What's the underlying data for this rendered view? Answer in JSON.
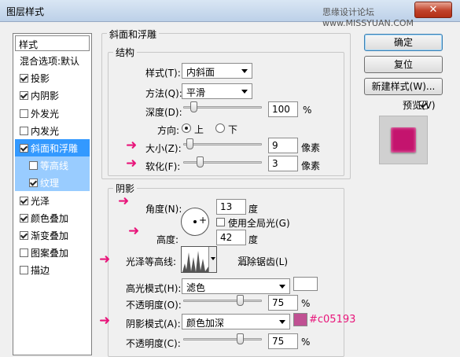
{
  "window": {
    "title": "图层样式",
    "watermark": "思缘设计论坛 www.MISSYUAN.COM",
    "close_icon": "✕"
  },
  "style_list": {
    "header": "样式",
    "items": [
      {
        "label": "混合选项:默认",
        "checkbox": false,
        "checked": false
      },
      {
        "label": "投影",
        "checkbox": true,
        "checked": true
      },
      {
        "label": "内阴影",
        "checkbox": true,
        "checked": true
      },
      {
        "label": "外发光",
        "checkbox": true,
        "checked": false
      },
      {
        "label": "内发光",
        "checkbox": true,
        "checked": false
      },
      {
        "label": "斜面和浮雕",
        "checkbox": true,
        "checked": true,
        "selected": true
      },
      {
        "label": "等高线",
        "checkbox": true,
        "checked": false,
        "sub": true
      },
      {
        "label": "纹理",
        "checkbox": true,
        "checked": true,
        "sub": true
      },
      {
        "label": "光泽",
        "checkbox": true,
        "checked": true
      },
      {
        "label": "颜色叠加",
        "checkbox": true,
        "checked": true
      },
      {
        "label": "渐变叠加",
        "checkbox": true,
        "checked": true
      },
      {
        "label": "图案叠加",
        "checkbox": true,
        "checked": false
      },
      {
        "label": "描边",
        "checkbox": true,
        "checked": false
      }
    ]
  },
  "bevel": {
    "section_title": "斜面和浮雕",
    "structure_title": "结构",
    "style_label": "样式(T):",
    "style_value": "内斜面",
    "method_label": "方法(Q):",
    "method_value": "平滑",
    "depth_label": "深度(D):",
    "depth_value": "100",
    "depth_unit": "%",
    "depth_level": 0.1,
    "direction_label": "方向:",
    "direction_up": "上",
    "direction_down": "下",
    "size_label": "大小(Z):",
    "size_value": "9",
    "size_unit": "像素",
    "size_level": 0.04,
    "soften_label": "软化(F):",
    "soften_value": "3",
    "soften_unit": "像素",
    "soften_level": 0.19
  },
  "shading": {
    "title": "阴影",
    "angle_label": "角度(N):",
    "angle_value": "13",
    "angle_unit": "度",
    "global_light_label": "使用全局光(G)",
    "altitude_label": "高度:",
    "altitude_value": "42",
    "altitude_unit": "度",
    "gloss_label": "光泽等高线:",
    "antialias_label": "消除锯齿(L)",
    "highlight_mode_label": "高光模式(H):",
    "highlight_mode_value": "滤色",
    "highlight_color": "#ffffff",
    "hl_opacity_label": "不透明度(O):",
    "hl_opacity_value": "75",
    "hl_opacity_unit": "%",
    "hl_opacity_level": 0.75,
    "shadow_mode_label": "阴影模式(A):",
    "shadow_mode_value": "颜色加深",
    "shadow_color": "#c05193",
    "shadow_color_note": "#c05193",
    "sh_opacity_label": "不透明度(C):",
    "sh_opacity_value": "75",
    "sh_opacity_unit": "%",
    "sh_opacity_level": 0.75
  },
  "buttons": {
    "ok": "确定",
    "reset": "复位",
    "new_style": "新建样式(W)...",
    "preview": "预览(V)"
  },
  "preview_color": "#c4146e",
  "annotation_color": "#e8157a"
}
